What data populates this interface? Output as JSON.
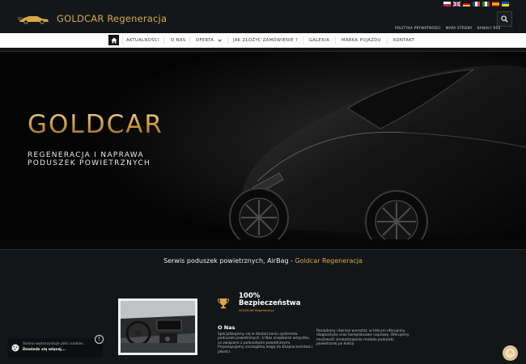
{
  "header": {
    "logo_text": "GOLDCAR Regeneracja",
    "flags": [
      "pl-flag",
      "uk-flag",
      "de-flag",
      "fr-flag",
      "fr-flag-2",
      "es-flag",
      "ua-flag"
    ],
    "top_links": [
      "POLITYKA PRYWATNOŚCI",
      "MAPA STRONY",
      "KANAŁY RSS"
    ]
  },
  "nav": {
    "items": [
      "AKTUALNOŚCI",
      "O NAS",
      "OFERTA",
      "JAK ZŁOŻYĆ ZAMÓWIENIE ?",
      "GALERIA",
      "MARKA POJAZDU",
      "KONTAKT"
    ]
  },
  "hero": {
    "title": "GOLDCAR",
    "subtitle_line1": "REGENERACJA I NAPRAWA",
    "subtitle_line2": "PODUSZEK POWIETRZNYCH"
  },
  "tagline": {
    "text": "Serwis poduszek powietrznych, AirBag - ",
    "highlight": "Goldcar Regeneracja"
  },
  "stats": {
    "value": "100%",
    "label": "Bezpieczeństwa",
    "sub": "GOLDCAR Regeneracja"
  },
  "about": {
    "heading": "O Nas",
    "text1": "Specjalizujemy się w dostarczaniu systemów poduszek powietrznych. U Nas znajdziesz wszystko, co związane z poduszkami powietrznymi. Przywiązujemy szczególną wagę do bezpieczeństwa i jakości.",
    "text2": "Posiadamy również warsztat, w którym oferujemy diagnostykę oraz kompleksowe naprawy. Oferujemy możliwość zrestartowania modułu poduszki powietrznej po kolizji."
  },
  "cookie": {
    "line1": "Strona wykorzystuje pliki cookies.",
    "line2": "Dowiedz się więcej...",
    "info": "!"
  },
  "colors": {
    "gold": "#d4a84b",
    "background": "#131618",
    "nav_bg": "#ffffff"
  }
}
